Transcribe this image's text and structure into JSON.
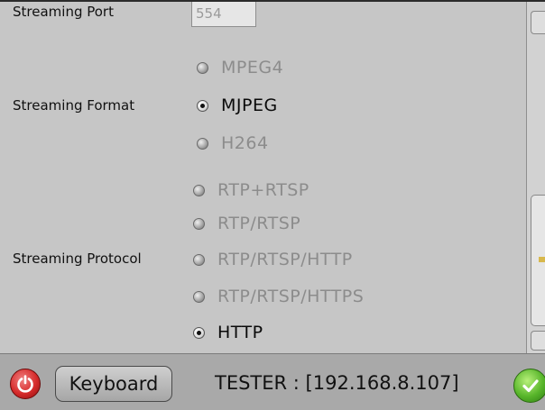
{
  "streaming_port": {
    "label": "Streaming Port",
    "value": "554"
  },
  "streaming_format": {
    "label": "Streaming Format",
    "options": [
      {
        "label": "MPEG4",
        "selected": false,
        "enabled": false
      },
      {
        "label": "MJPEG",
        "selected": true,
        "enabled": true
      },
      {
        "label": "H264",
        "selected": false,
        "enabled": false
      }
    ]
  },
  "streaming_protocol": {
    "label": "Streaming Protocol",
    "options": [
      {
        "label": "RTP+RTSP",
        "selected": false,
        "enabled": false
      },
      {
        "label": "RTP/RTSP",
        "selected": false,
        "enabled": false
      },
      {
        "label": "RTP/RTSP/HTTP",
        "selected": false,
        "enabled": false
      },
      {
        "label": "RTP/RTSP/HTTPS",
        "selected": false,
        "enabled": false
      },
      {
        "label": "HTTP",
        "selected": true,
        "enabled": true
      }
    ]
  },
  "bottom_bar": {
    "keyboard_label": "Keyboard",
    "status": "TESTER : [192.168.8.107]"
  },
  "colors": {
    "power": "#d62b2b",
    "ok": "#57b52a",
    "panel": "#c6c6c6",
    "bar": "#a9a9a9"
  }
}
